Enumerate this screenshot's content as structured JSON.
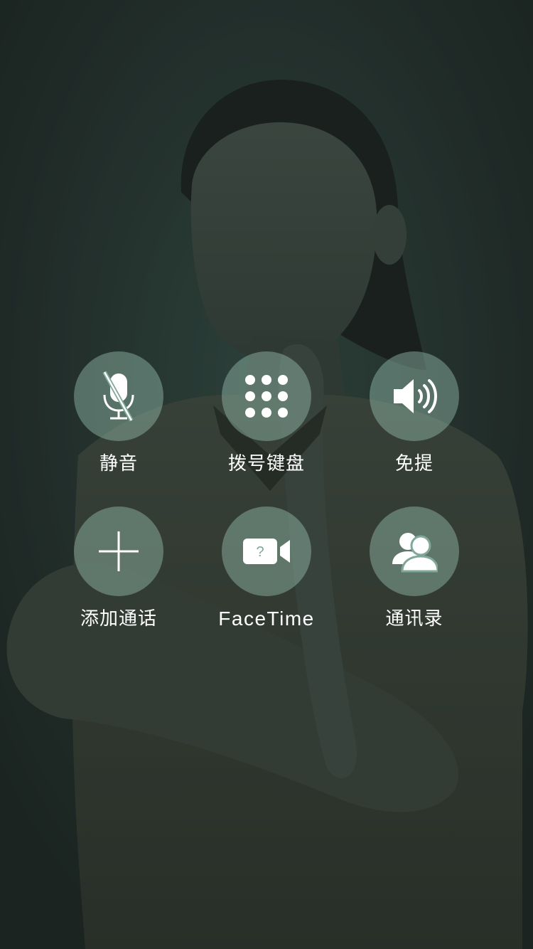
{
  "call_controls": {
    "mute": {
      "label": "静音",
      "icon": "mic-muted-icon"
    },
    "keypad": {
      "label": "拨号键盘",
      "icon": "keypad-grid-icon"
    },
    "speaker": {
      "label": "免提",
      "icon": "speaker-icon"
    },
    "add_call": {
      "label": "添加通话",
      "icon": "plus-icon"
    },
    "facetime": {
      "label": "FaceTime",
      "icon": "video-camera-icon"
    },
    "contacts": {
      "label": "通讯录",
      "icon": "contacts-icon"
    }
  },
  "colors": {
    "button_fill": "#7fa898",
    "icon": "#ffffff",
    "label": "#ffffff",
    "background": "#2b3934"
  }
}
